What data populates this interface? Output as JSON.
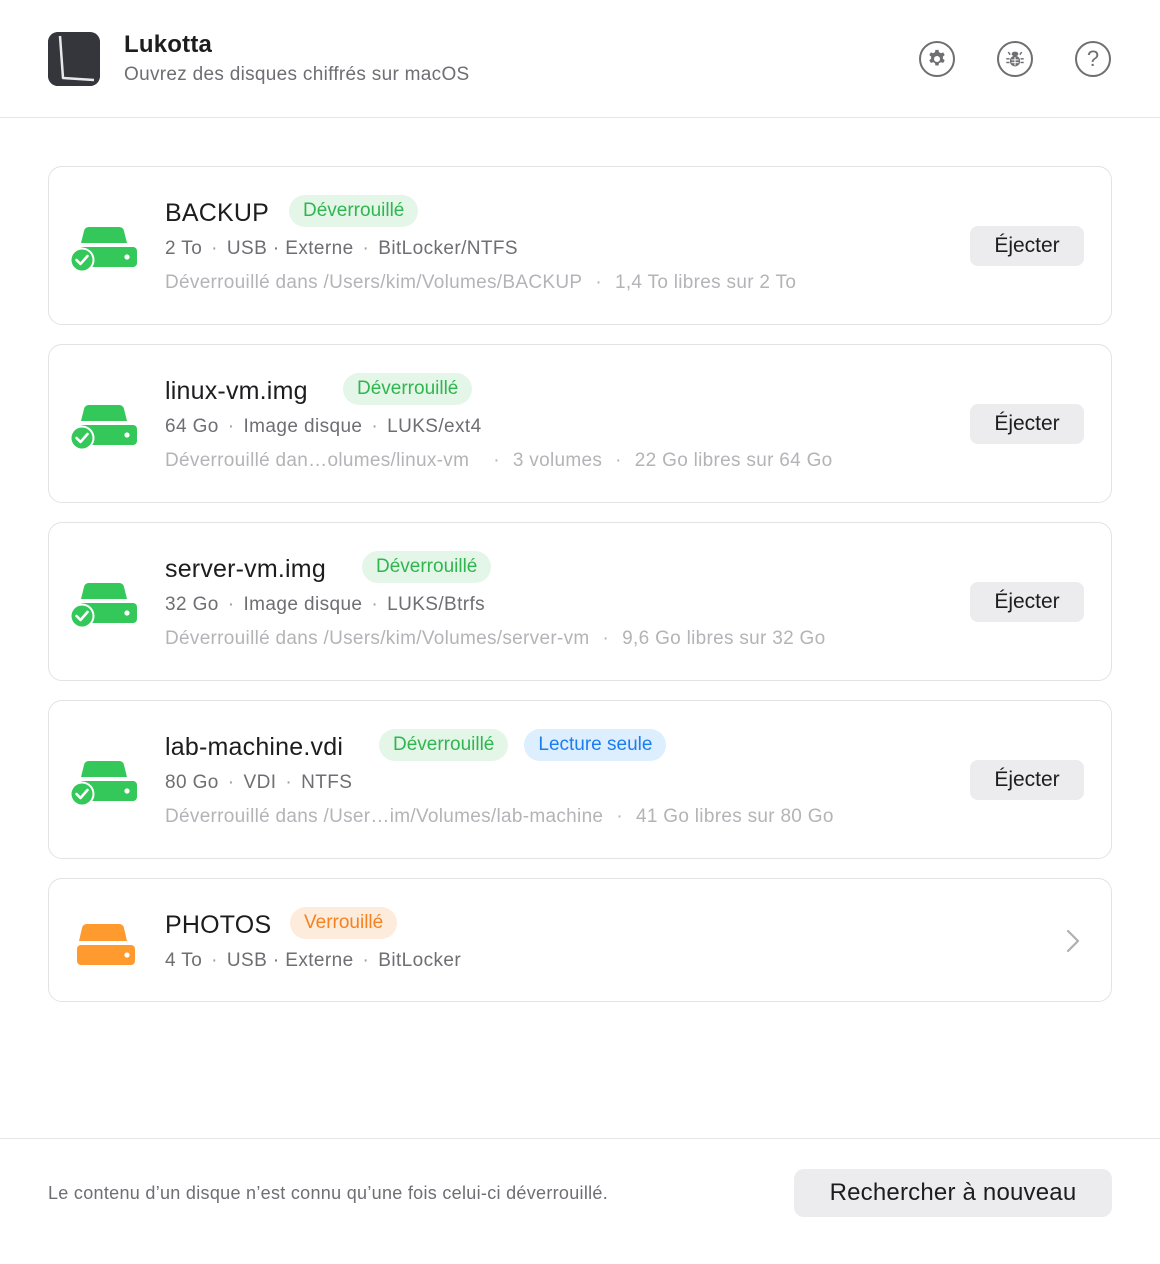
{
  "app": {
    "title": "Lukotta",
    "subtitle": "Ouvrez des disques chiffrés sur macOS"
  },
  "header_icons": [
    "gear-icon",
    "bug-icon",
    "help-icon"
  ],
  "colors": {
    "unlocked": "#34c759",
    "locked": "#ff9a2e",
    "readonly": "#1a7df2"
  },
  "disks": [
    {
      "name": "BACKUP",
      "badges": [
        "Déverrouillé"
      ],
      "meta": [
        "2 To",
        "USB · Externe",
        "BitLocker/NTFS"
      ],
      "detail": [
        "Déverrouillé dans /Users/kim/Volumes/BACKUP",
        "1,4 To libres sur 2 To"
      ],
      "action": "Éjecter",
      "status": "unlocked"
    },
    {
      "name": "linux-vm.img",
      "badges": [
        "Déverrouillé"
      ],
      "meta": [
        "64 Go",
        "Image disque",
        "LUKS/ext4"
      ],
      "detail": [
        "Déverrouillé dan…olumes/linux-vm",
        "3 volumes",
        "22 Go libres sur 64 Go"
      ],
      "action": "Éjecter",
      "status": "unlocked"
    },
    {
      "name": "server-vm.img",
      "badges": [
        "Déverrouillé"
      ],
      "meta": [
        "32 Go",
        "Image disque",
        "LUKS/Btrfs"
      ],
      "detail": [
        "Déverrouillé dans /Users/kim/Volumes/server-vm",
        "9,6 Go libres sur 32 Go"
      ],
      "action": "Éjecter",
      "status": "unlocked"
    },
    {
      "name": "lab-machine.vdi",
      "badges": [
        "Déverrouillé",
        "Lecture seule"
      ],
      "meta": [
        "80 Go",
        "VDI",
        "NTFS"
      ],
      "detail": [
        "Déverrouillé dans /User…im/Volumes/lab-machine",
        "41 Go libres sur 80 Go"
      ],
      "action": "Éjecter",
      "status": "unlocked"
    },
    {
      "name": "PHOTOS",
      "badges": [
        "Verrouillé"
      ],
      "meta": [
        "4 To",
        "USB · Externe",
        "BitLocker"
      ],
      "status": "locked"
    }
  ],
  "footer": {
    "note": "Le contenu d’un disque n’est connu qu’une fois celui-ci déverrouillé.",
    "rescan_label": "Rechercher à nouveau"
  }
}
